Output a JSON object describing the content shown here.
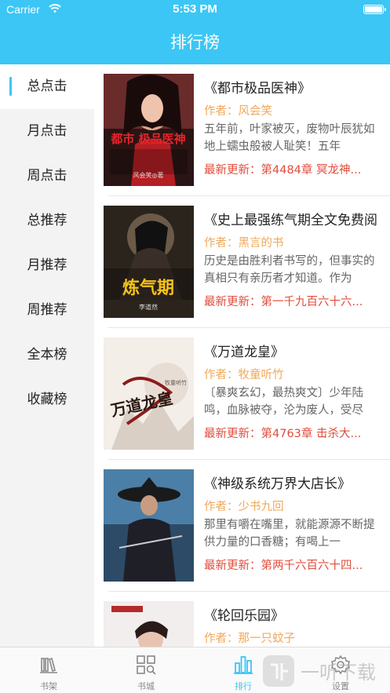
{
  "status": {
    "carrier": "Carrier",
    "time": "5:53 PM"
  },
  "header": {
    "title": "排行榜"
  },
  "sidebar": {
    "items": [
      {
        "label": "总点击",
        "active": true
      },
      {
        "label": "月点击"
      },
      {
        "label": "周点击"
      },
      {
        "label": "总推荐"
      },
      {
        "label": "月推荐"
      },
      {
        "label": "周推荐"
      },
      {
        "label": "全本榜"
      },
      {
        "label": "收藏榜"
      }
    ]
  },
  "books": [
    {
      "title": "《都市极品医神》",
      "author": "作者：风会笑",
      "desc": "五年前，叶家被灭，废物叶辰犹如地上蠕虫般被人耻笑！五年",
      "update": "最新更新：第4484章 冥龙神...",
      "cover_text": "都市 极品医神",
      "cover_author": "风会笑◎著"
    },
    {
      "title": "《史上最强练气期全文免费阅",
      "author": "作者：黑言的书",
      "desc": "历史是由胜利者书写的，但事实的真相只有亲历者才知道。作为",
      "update": "最新更新：第一千九百六十六...",
      "cover_text": "炼气期",
      "cover_author": "李道然"
    },
    {
      "title": "《万道龙皇》",
      "author": "作者：牧童听竹",
      "desc": "〔暴爽玄幻，最热爽文〕少年陆鸣，血脉被夺，沦为废人，受尽",
      "update": "最新更新：第4763章 击杀大...",
      "cover_text": "万道龙皇",
      "cover_author": "牧童听竹"
    },
    {
      "title": "《神级系统万界大店长》",
      "author": "作者：少书九回",
      "desc": "那里有嚼在嘴里，就能源源不断提供力量的口香糖；有喝上一",
      "update": "最新更新：第两千六百六十四...",
      "cover_text": "",
      "cover_author": ""
    },
    {
      "title": "《轮回乐园》",
      "author": "作者：那一只蚊子",
      "desc": "",
      "update": "",
      "cover_text": "",
      "cover_author": ""
    }
  ],
  "tabs": [
    {
      "label": "书架",
      "icon": "bookshelf-icon"
    },
    {
      "label": "书城",
      "icon": "grid-search-icon"
    },
    {
      "label": "排行",
      "icon": "ranking-icon",
      "active": true
    },
    {
      "label": "设置",
      "icon": "gear-icon"
    }
  ],
  "watermark": {
    "text": "一听下载"
  },
  "colors": {
    "accent": "#3cc6f5",
    "author": "#f0a85a",
    "update": "#e14b3b"
  }
}
